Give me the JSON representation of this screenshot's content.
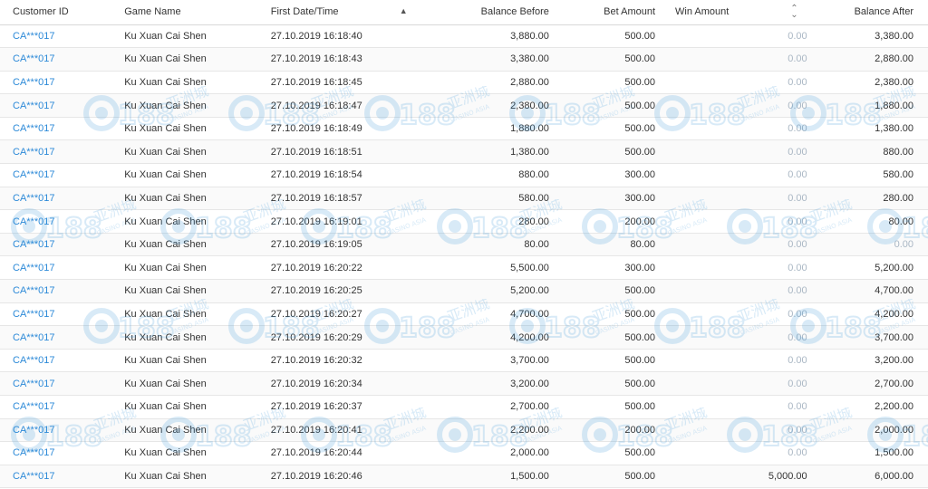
{
  "table": {
    "headers": {
      "customer_id": "Customer ID",
      "game_name": "Game Name",
      "first_datetime": "First Date/Time",
      "balance_before": "Balance Before",
      "bet_amount": "Bet Amount",
      "win_amount": "Win Amount",
      "balance_after": "Balance After"
    },
    "rows": [
      {
        "customer_id": "CA***017",
        "game": "Ku Xuan Cai Shen",
        "datetime": "27.10.2019 16:18:40",
        "balance_before": "3,880.00",
        "bet": "500.00",
        "win": "0.00",
        "balance_after": "3,380.00"
      },
      {
        "customer_id": "CA***017",
        "game": "Ku Xuan Cai Shen",
        "datetime": "27.10.2019 16:18:43",
        "balance_before": "3,380.00",
        "bet": "500.00",
        "win": "0.00",
        "balance_after": "2,880.00"
      },
      {
        "customer_id": "CA***017",
        "game": "Ku Xuan Cai Shen",
        "datetime": "27.10.2019 16:18:45",
        "balance_before": "2,880.00",
        "bet": "500.00",
        "win": "0.00",
        "balance_after": "2,380.00"
      },
      {
        "customer_id": "CA***017",
        "game": "Ku Xuan Cai Shen",
        "datetime": "27.10.2019 16:18:47",
        "balance_before": "2,380.00",
        "bet": "500.00",
        "win": "0.00",
        "balance_after": "1,880.00"
      },
      {
        "customer_id": "CA***017",
        "game": "Ku Xuan Cai Shen",
        "datetime": "27.10.2019 16:18:49",
        "balance_before": "1,880.00",
        "bet": "500.00",
        "win": "0.00",
        "balance_after": "1,380.00"
      },
      {
        "customer_id": "CA***017",
        "game": "Ku Xuan Cai Shen",
        "datetime": "27.10.2019 16:18:51",
        "balance_before": "1,380.00",
        "bet": "500.00",
        "win": "0.00",
        "balance_after": "880.00"
      },
      {
        "customer_id": "CA***017",
        "game": "Ku Xuan Cai Shen",
        "datetime": "27.10.2019 16:18:54",
        "balance_before": "880.00",
        "bet": "300.00",
        "win": "0.00",
        "balance_after": "580.00"
      },
      {
        "customer_id": "CA***017",
        "game": "Ku Xuan Cai Shen",
        "datetime": "27.10.2019 16:18:57",
        "balance_before": "580.00",
        "bet": "300.00",
        "win": "0.00",
        "balance_after": "280.00"
      },
      {
        "customer_id": "CA***017",
        "game": "Ku Xuan Cai Shen",
        "datetime": "27.10.2019 16:19:01",
        "balance_before": "280.00",
        "bet": "200.00",
        "win": "0.00",
        "balance_after": "80.00"
      },
      {
        "customer_id": "CA***017",
        "game": "Ku Xuan Cai Shen",
        "datetime": "27.10.2019 16:19:05",
        "balance_before": "80.00",
        "bet": "80.00",
        "win": "0.00",
        "balance_after": "0.00"
      },
      {
        "customer_id": "CA***017",
        "game": "Ku Xuan Cai Shen",
        "datetime": "27.10.2019 16:20:22",
        "balance_before": "5,500.00",
        "bet": "300.00",
        "win": "0.00",
        "balance_after": "5,200.00"
      },
      {
        "customer_id": "CA***017",
        "game": "Ku Xuan Cai Shen",
        "datetime": "27.10.2019 16:20:25",
        "balance_before": "5,200.00",
        "bet": "500.00",
        "win": "0.00",
        "balance_after": "4,700.00"
      },
      {
        "customer_id": "CA***017",
        "game": "Ku Xuan Cai Shen",
        "datetime": "27.10.2019 16:20:27",
        "balance_before": "4,700.00",
        "bet": "500.00",
        "win": "0.00",
        "balance_after": "4,200.00"
      },
      {
        "customer_id": "CA***017",
        "game": "Ku Xuan Cai Shen",
        "datetime": "27.10.2019 16:20:29",
        "balance_before": "4,200.00",
        "bet": "500.00",
        "win": "0.00",
        "balance_after": "3,700.00"
      },
      {
        "customer_id": "CA***017",
        "game": "Ku Xuan Cai Shen",
        "datetime": "27.10.2019 16:20:32",
        "balance_before": "3,700.00",
        "bet": "500.00",
        "win": "0.00",
        "balance_after": "3,200.00"
      },
      {
        "customer_id": "CA***017",
        "game": "Ku Xuan Cai Shen",
        "datetime": "27.10.2019 16:20:34",
        "balance_before": "3,200.00",
        "bet": "500.00",
        "win": "0.00",
        "balance_after": "2,700.00"
      },
      {
        "customer_id": "CA***017",
        "game": "Ku Xuan Cai Shen",
        "datetime": "27.10.2019 16:20:37",
        "balance_before": "2,700.00",
        "bet": "500.00",
        "win": "0.00",
        "balance_after": "2,200.00"
      },
      {
        "customer_id": "CA***017",
        "game": "Ku Xuan Cai Shen",
        "datetime": "27.10.2019 16:20:41",
        "balance_before": "2,200.00",
        "bet": "200.00",
        "win": "0.00",
        "balance_after": "2,000.00"
      },
      {
        "customer_id": "CA***017",
        "game": "Ku Xuan Cai Shen",
        "datetime": "27.10.2019 16:20:44",
        "balance_before": "2,000.00",
        "bet": "500.00",
        "win": "0.00",
        "balance_after": "1,500.00"
      },
      {
        "customer_id": "CA***017",
        "game": "Ku Xuan Cai Shen",
        "datetime": "27.10.2019 16:20:46",
        "balance_before": "1,500.00",
        "bet": "500.00",
        "win": "5,000.00",
        "balance_after": "6,000.00"
      }
    ]
  },
  "icons": {
    "sort_asc": "sort-ascending-icon",
    "sort_both": "sort-unsorted-icon"
  },
  "watermark": {
    "brand": "188",
    "text_cn": "亚洲城",
    "text_en": "CASINO ASIA"
  },
  "colors": {
    "link": "#2d8ad8",
    "muted": "#aab7c4",
    "watermark": "#2b8fd6"
  }
}
